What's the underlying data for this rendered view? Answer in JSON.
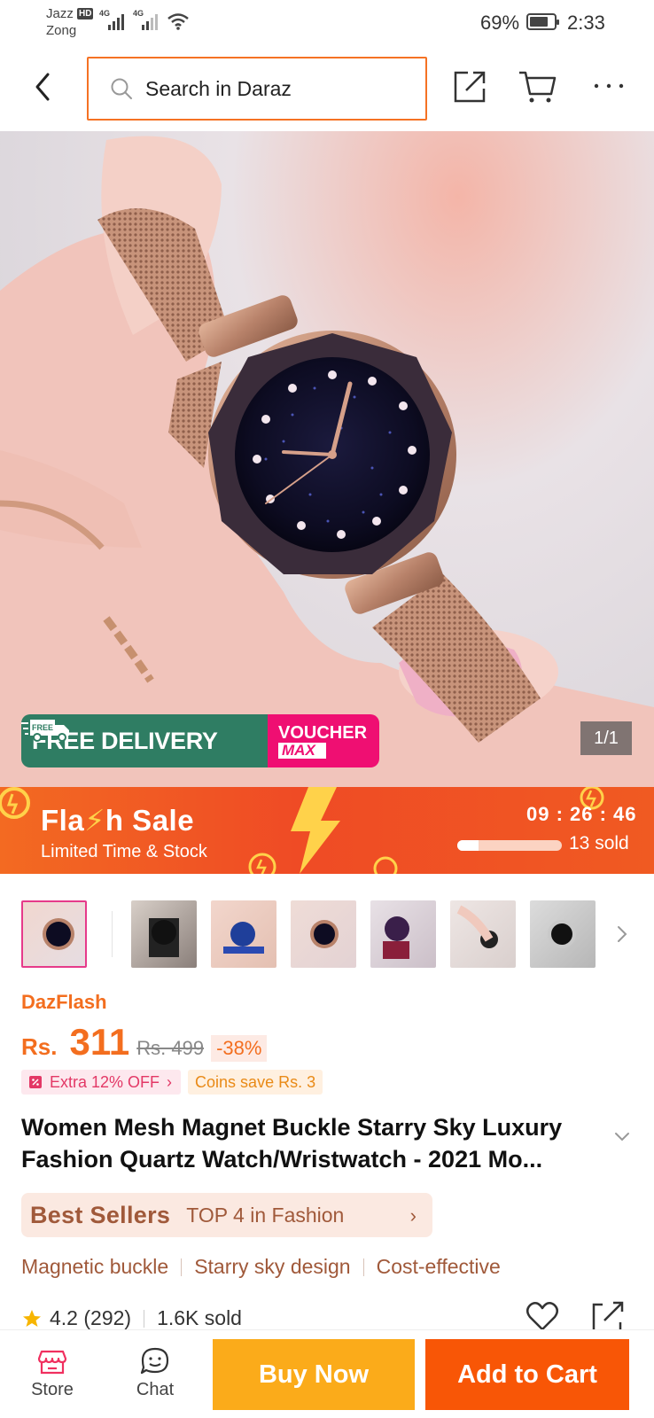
{
  "status_bar": {
    "carrier1": "Jazz",
    "hd_badge": "HD",
    "carrier2": "Zong",
    "network1": "4G",
    "network2": "4G",
    "battery": "69%",
    "time": "2:33"
  },
  "header": {
    "search_placeholder": "Search in Daraz"
  },
  "hero": {
    "free_delivery": "FREE DELIVERY",
    "free_tag": "FREE",
    "voucher_line1": "VOUCHER",
    "voucher_line2": "MAX",
    "image_counter": "1/1"
  },
  "flash_sale": {
    "title_part1": "Fla",
    "title_bolt": "⚡",
    "title_part2": "h Sale",
    "subtitle": "Limited Time & Stock",
    "timer": "09 : 26 : 46",
    "sold": "13 sold",
    "sold_progress": 0.2
  },
  "product": {
    "badge": "DazFlash",
    "currency": "Rs.",
    "price": "311",
    "old_price": "Rs. 499",
    "discount": "-38%",
    "extra_off": "Extra 12% OFF",
    "coins": "Coins save Rs. 3",
    "title": "Women Mesh Magnet Buckle Starry Sky Luxury Fashion Quartz Watch/Wristwatch - 2021 Mo...",
    "bestsellers_logo": "Best Sellers",
    "bestsellers_text": "TOP 4 in Fashion",
    "features": [
      "Magnetic buckle",
      "Starry sky design",
      "Cost-effective"
    ],
    "rating": "4.2",
    "rating_count": "(292)",
    "sold": "1.6K sold"
  },
  "bottom_bar": {
    "store": "Store",
    "chat": "Chat",
    "buy_now": "Buy Now",
    "add_to_cart": "Add to Cart"
  },
  "colors": {
    "accent": "#f57224",
    "buy_now": "#fbab1a",
    "add_to_cart": "#f85606",
    "free_delivery": "#2f7d63",
    "voucher": "#ef0f72"
  }
}
